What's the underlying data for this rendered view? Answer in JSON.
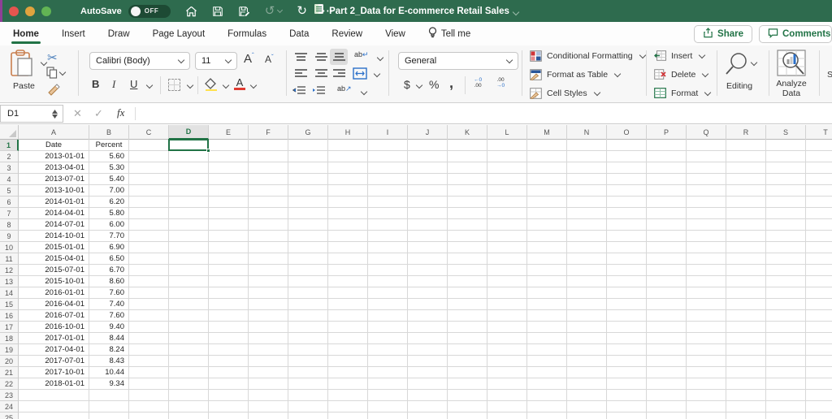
{
  "titlebar": {
    "autosave_label": "AutoSave",
    "autosave_state": "OFF",
    "title": "Part 2_Data for E-commerce Retail Sales"
  },
  "tabs": {
    "items": [
      {
        "label": "Home",
        "active": true
      },
      {
        "label": "Insert",
        "active": false
      },
      {
        "label": "Draw",
        "active": false
      },
      {
        "label": "Page Layout",
        "active": false
      },
      {
        "label": "Formulas",
        "active": false
      },
      {
        "label": "Data",
        "active": false
      },
      {
        "label": "Review",
        "active": false
      },
      {
        "label": "View",
        "active": false
      }
    ],
    "tellme_label": "Tell me",
    "share_label": "Share",
    "comments_label": "Comments"
  },
  "ribbon": {
    "paste_label": "Paste",
    "font_name": "Calibri (Body)",
    "font_size": "11",
    "bold": "B",
    "italic": "I",
    "underline": "U",
    "number_format": "General",
    "currency": "$",
    "percent": "%",
    "comma": ",",
    "inc_dec_top": "←0",
    "inc_dec_bottom": ".00",
    "dec_dec_top": ".00",
    "dec_dec_bottom": "→0",
    "conditional_formatting": "Conditional Formatting",
    "format_as_table": "Format as Table",
    "cell_styles": "Cell Styles",
    "insert": "Insert",
    "delete": "Delete",
    "format": "Format",
    "editing": "Editing",
    "analyze_line1": "Analyze",
    "analyze_line2": "Data",
    "sensitivity_clipped": "S"
  },
  "formula_bar": {
    "name_box": "D1",
    "fx": "fx"
  },
  "sheet": {
    "columns": [
      "A",
      "B",
      "C",
      "D",
      "E",
      "F",
      "G",
      "H",
      "I",
      "J",
      "K",
      "L",
      "M",
      "N",
      "O",
      "P",
      "Q",
      "R",
      "S",
      "T"
    ],
    "selected_cell": "D1",
    "selected_column": "D",
    "selected_row": 1,
    "visible_rows": 25,
    "header_row": {
      "A": "Date",
      "B": "Percent"
    },
    "records": [
      {
        "date": "2013-01-01",
        "percent": "5.60"
      },
      {
        "date": "2013-04-01",
        "percent": "5.30"
      },
      {
        "date": "2013-07-01",
        "percent": "5.40"
      },
      {
        "date": "2013-10-01",
        "percent": "7.00"
      },
      {
        "date": "2014-01-01",
        "percent": "6.20"
      },
      {
        "date": "2014-04-01",
        "percent": "5.80"
      },
      {
        "date": "2014-07-01",
        "percent": "6.00"
      },
      {
        "date": "2014-10-01",
        "percent": "7.70"
      },
      {
        "date": "2015-01-01",
        "percent": "6.90"
      },
      {
        "date": "2015-04-01",
        "percent": "6.50"
      },
      {
        "date": "2015-07-01",
        "percent": "6.70"
      },
      {
        "date": "2015-10-01",
        "percent": "8.60"
      },
      {
        "date": "2016-01-01",
        "percent": "7.60"
      },
      {
        "date": "2016-04-01",
        "percent": "7.40"
      },
      {
        "date": "2016-07-01",
        "percent": "7.60"
      },
      {
        "date": "2016-10-01",
        "percent": "9.40"
      },
      {
        "date": "2017-01-01",
        "percent": "8.44"
      },
      {
        "date": "2017-04-01",
        "percent": "8.24"
      },
      {
        "date": "2017-07-01",
        "percent": "8.43"
      },
      {
        "date": "2017-10-01",
        "percent": "10.44"
      },
      {
        "date": "2018-01-01",
        "percent": "9.34"
      }
    ],
    "colors": {
      "accent_green": "#217346",
      "gridline": "#d8d8d8",
      "header_bg": "#f5f5f5",
      "header_selected_bg": "#e2e2e2"
    }
  }
}
